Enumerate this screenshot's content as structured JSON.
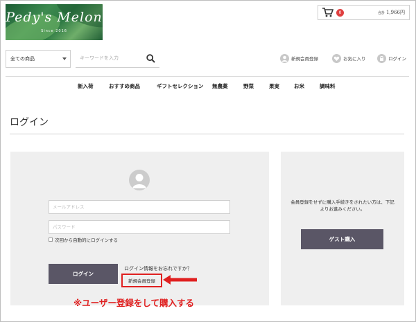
{
  "logo": {
    "brand": "Pedy's Melon",
    "since": "Since 2016"
  },
  "cart": {
    "count": "0",
    "total_label": "合計",
    "total_value": "1,966円"
  },
  "search": {
    "category": "全ての商品",
    "placeholder": "キーワードを入力"
  },
  "user_links": {
    "register": "新規会員登録",
    "favorites": "お気に入り",
    "login": "ログイン"
  },
  "nav": [
    "新入荷",
    "おすすめ商品",
    "ギフトセレクション",
    "無農薬",
    "野菜",
    "果実",
    "お米",
    "調味料"
  ],
  "page": {
    "title": "ログイン"
  },
  "login_form": {
    "email_placeholder": "メールアドレス",
    "password_placeholder": "パスワード",
    "remember_label": "次回から自動的にログインする",
    "login_button": "ログイン",
    "forgot_link": "ログイン情報をお忘れですか？",
    "register_link": "新規会員登録"
  },
  "guest": {
    "text": "会員登録をせずに購入手続きをされたい方は、下記よりお進みください。",
    "button": "ゲスト購入"
  },
  "annotation": {
    "callout": "※ユーザー登録をして購入する",
    "color": "#e02020"
  }
}
